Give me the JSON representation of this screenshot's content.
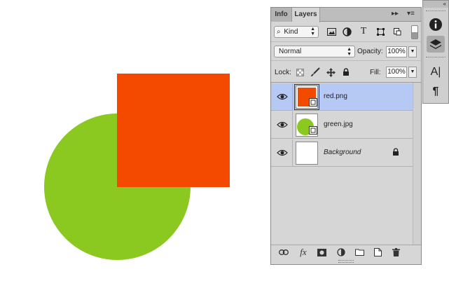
{
  "colors": {
    "circle": "#8bc820",
    "square": "#f44a00",
    "selected_row": "#b6c9f5",
    "panel_bg": "#d6d6d6"
  },
  "panel": {
    "tabs": [
      {
        "label": "Info"
      },
      {
        "label": "Layers"
      }
    ],
    "tab_controls": {
      "collapse": "▸▸",
      "menu": "▾≡"
    },
    "filter": {
      "kind_label": "Kind",
      "icons": [
        "image-filter-icon",
        "adjustment-filter-icon",
        "type-filter-icon",
        "shape-filter-icon",
        "smart-object-filter-icon"
      ]
    },
    "blend_mode": "Normal",
    "opacity_label": "Opacity:",
    "opacity_value": "100%",
    "lock_label": "Lock:",
    "fill_label": "Fill:",
    "fill_value": "100%",
    "layers": [
      {
        "name": "red.png",
        "selected": true,
        "thumb_color": "#f44a00"
      },
      {
        "name": "green.jpg",
        "selected": false,
        "thumb_color": "#8bc820"
      },
      {
        "name": "Background",
        "selected": false,
        "thumb_color": "#ffffff"
      }
    ],
    "footer_icons": [
      "link-layers-icon",
      "fx-icon",
      "add-mask-icon",
      "adjustment-layer-icon",
      "new-group-icon",
      "new-layer-icon",
      "trash-icon"
    ],
    "fx_label": "fx"
  },
  "dock": {
    "collapse": "«",
    "type_glyph": "A|",
    "paragraph_glyph": "¶",
    "info_glyph": "i"
  }
}
